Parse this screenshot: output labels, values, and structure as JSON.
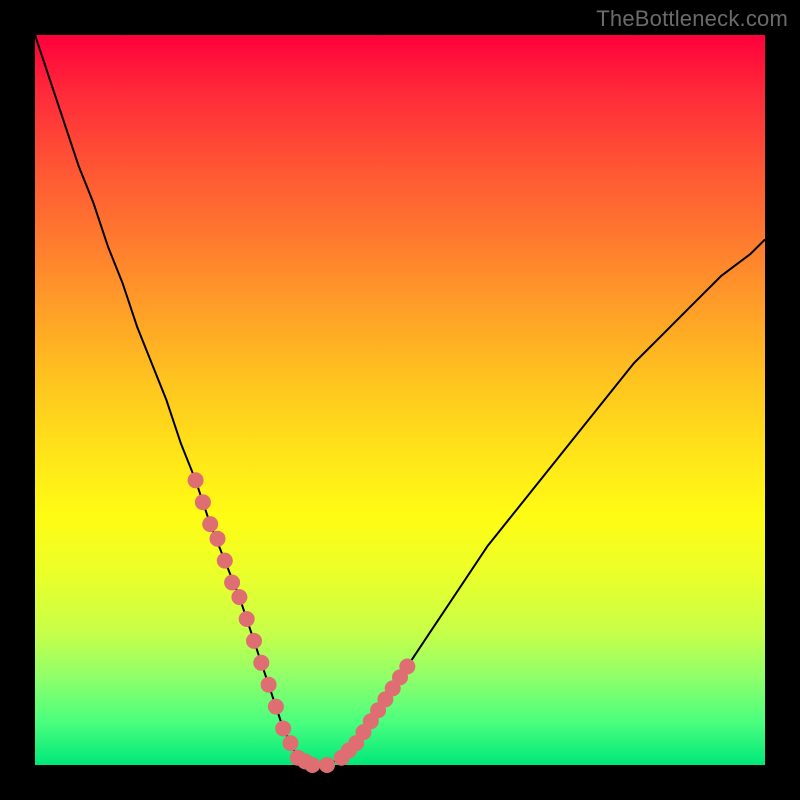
{
  "watermark": "TheBottleneck.com",
  "colors": {
    "curve_stroke": "#000000",
    "marker_fill": "#de6e72",
    "marker_stroke": "#de6e72"
  },
  "chart_data": {
    "type": "line",
    "title": "",
    "xlabel": "",
    "ylabel": "",
    "xlim": [
      0,
      100
    ],
    "ylim": [
      0,
      100
    ],
    "x": [
      0,
      2,
      4,
      6,
      8,
      10,
      12,
      14,
      16,
      18,
      20,
      22,
      24,
      26,
      28,
      30,
      31,
      32,
      33,
      34,
      35,
      36,
      38,
      40,
      42,
      44,
      46,
      48,
      50,
      54,
      58,
      62,
      66,
      70,
      74,
      78,
      82,
      86,
      90,
      94,
      98,
      100
    ],
    "y": [
      100,
      94,
      88,
      82,
      77,
      71,
      66,
      60,
      55,
      50,
      44,
      39,
      33,
      28,
      23,
      17,
      14,
      11,
      8,
      5,
      3,
      1,
      0,
      0,
      1,
      3,
      6,
      9,
      12,
      18,
      24,
      30,
      35,
      40,
      45,
      50,
      55,
      59,
      63,
      67,
      70,
      72
    ],
    "markers": {
      "x": [
        22,
        23,
        24,
        25,
        26,
        27,
        28,
        29,
        30,
        31,
        32,
        33,
        34,
        35,
        36,
        37,
        38,
        40,
        42,
        43,
        44,
        45,
        46,
        47,
        48,
        49,
        50,
        51
      ],
      "y": [
        39,
        36,
        33,
        31,
        28,
        25,
        23,
        20,
        17,
        14,
        11,
        8,
        5,
        3,
        1,
        0.5,
        0,
        0,
        1,
        2,
        3,
        4.5,
        6,
        7.5,
        9,
        10.5,
        12,
        13.5
      ]
    }
  }
}
